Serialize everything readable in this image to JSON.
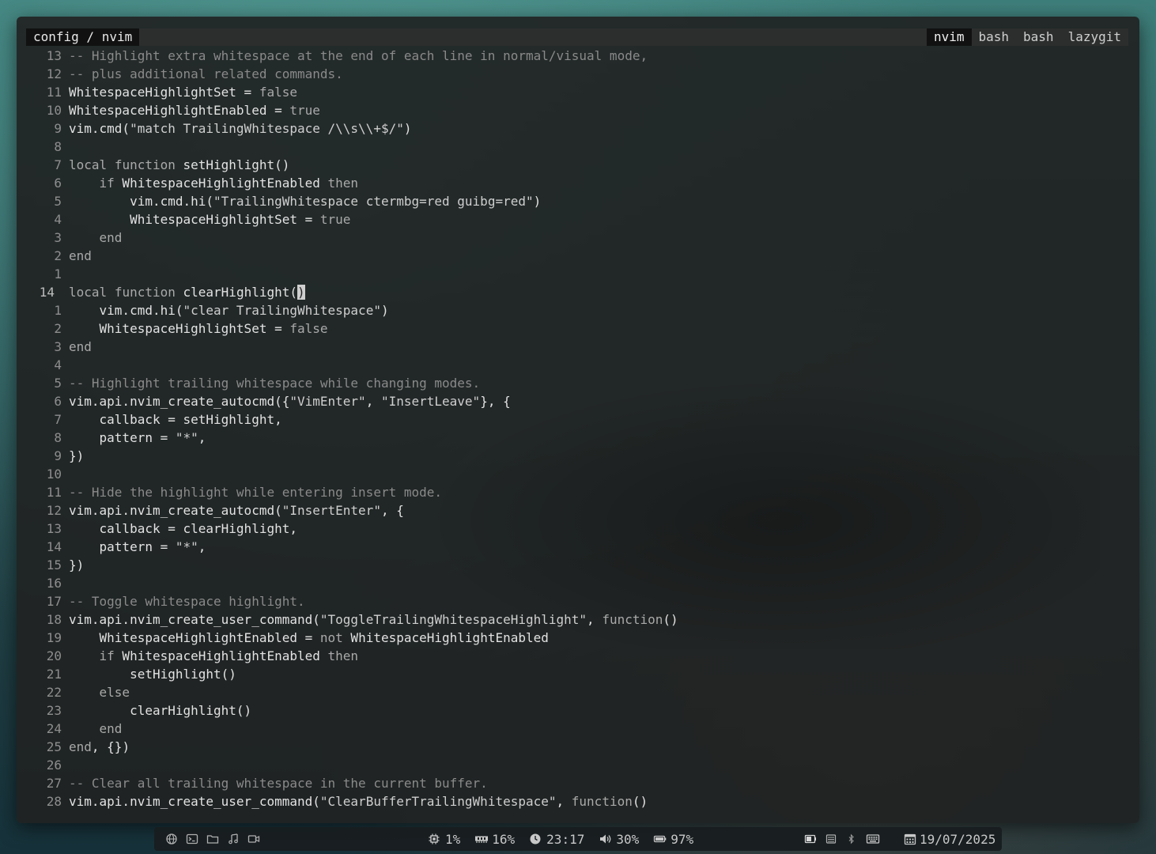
{
  "tmux": {
    "session": "config / nvim",
    "windows": [
      {
        "label": "nvim",
        "active": true
      },
      {
        "label": "bash",
        "active": false
      },
      {
        "label": "bash",
        "active": false
      },
      {
        "label": "lazygit",
        "active": false
      }
    ]
  },
  "editor": {
    "lines": [
      {
        "n": "13",
        "code": "-- Highlight extra whitespace at the end of each line in normal/visual mode,"
      },
      {
        "n": "12",
        "code": "-- plus additional related commands."
      },
      {
        "n": "11",
        "code": "WhitespaceHighlightSet = false"
      },
      {
        "n": "10",
        "code": "WhitespaceHighlightEnabled = true"
      },
      {
        "n": "9",
        "code": "vim.cmd(\"match TrailingWhitespace /\\\\s\\\\+$/\")"
      },
      {
        "n": "8",
        "code": ""
      },
      {
        "n": "7",
        "code": "local function setHighlight()"
      },
      {
        "n": "6",
        "code": "    if WhitespaceHighlightEnabled then"
      },
      {
        "n": "5",
        "code": "        vim.cmd.hi(\"TrailingWhitespace ctermbg=red guibg=red\")"
      },
      {
        "n": "4",
        "code": "        WhitespaceHighlightSet = true"
      },
      {
        "n": "3",
        "code": "    end"
      },
      {
        "n": "2",
        "code": "end"
      },
      {
        "n": "1",
        "code": ""
      },
      {
        "n": "14",
        "code": "local function clearHighlight()",
        "current": true
      },
      {
        "n": "1",
        "code": "    vim.cmd.hi(\"clear TrailingWhitespace\")"
      },
      {
        "n": "2",
        "code": "    WhitespaceHighlightSet = false"
      },
      {
        "n": "3",
        "code": "end"
      },
      {
        "n": "4",
        "code": ""
      },
      {
        "n": "5",
        "code": "-- Highlight trailing whitespace while changing modes."
      },
      {
        "n": "6",
        "code": "vim.api.nvim_create_autocmd({\"VimEnter\", \"InsertLeave\"}, {"
      },
      {
        "n": "7",
        "code": "    callback = setHighlight,"
      },
      {
        "n": "8",
        "code": "    pattern = \"*\","
      },
      {
        "n": "9",
        "code": "})"
      },
      {
        "n": "10",
        "code": ""
      },
      {
        "n": "11",
        "code": "-- Hide the highlight while entering insert mode."
      },
      {
        "n": "12",
        "code": "vim.api.nvim_create_autocmd(\"InsertEnter\", {"
      },
      {
        "n": "13",
        "code": "    callback = clearHighlight,"
      },
      {
        "n": "14",
        "code": "    pattern = \"*\","
      },
      {
        "n": "15",
        "code": "})"
      },
      {
        "n": "16",
        "code": ""
      },
      {
        "n": "17",
        "code": "-- Toggle whitespace highlight."
      },
      {
        "n": "18",
        "code": "vim.api.nvim_create_user_command(\"ToggleTrailingWhitespaceHighlight\", function()"
      },
      {
        "n": "19",
        "code": "    WhitespaceHighlightEnabled = not WhitespaceHighlightEnabled"
      },
      {
        "n": "20",
        "code": "    if WhitespaceHighlightEnabled then"
      },
      {
        "n": "21",
        "code": "        setHighlight()"
      },
      {
        "n": "22",
        "code": "    else"
      },
      {
        "n": "23",
        "code": "        clearHighlight()"
      },
      {
        "n": "24",
        "code": "    end"
      },
      {
        "n": "25",
        "code": "end, {})"
      },
      {
        "n": "26",
        "code": ""
      },
      {
        "n": "27",
        "code": "-- Clear all trailing whitespace in the current buffer."
      },
      {
        "n": "28",
        "code": "vim.api.nvim_create_user_command(\"ClearBufferTrailingWhitespace\", function()"
      }
    ]
  },
  "statusbar": {
    "launchers": [
      {
        "icon": "globe-icon"
      },
      {
        "icon": "terminal-icon"
      },
      {
        "icon": "folder-icon"
      },
      {
        "icon": "music-icon"
      },
      {
        "icon": "video-icon"
      }
    ],
    "cpu": "1%",
    "memory": "16%",
    "time": "23:17",
    "volume": "30%",
    "battery": "97%",
    "tray": [
      {
        "icon": "battery-tray-icon"
      },
      {
        "icon": "drive-icon"
      },
      {
        "icon": "bluetooth-icon"
      },
      {
        "icon": "keyboard-icon"
      }
    ],
    "date": "19/07/2025"
  }
}
